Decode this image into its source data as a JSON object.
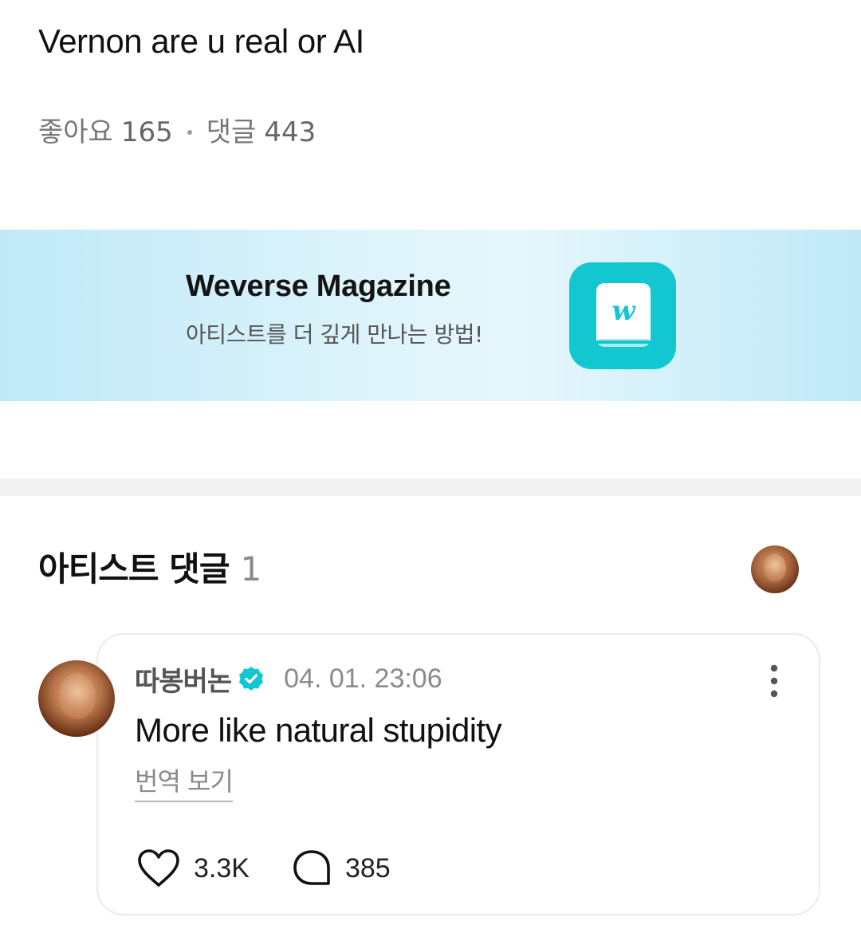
{
  "post": {
    "title": "Vernon are u real or AI",
    "likes_label": "좋아요",
    "likes_count": "165",
    "comments_label": "댓글",
    "comments_count": "443"
  },
  "banner": {
    "title": "Weverse Magazine",
    "subtitle": "아티스트를 더 깊게 만나는 방법!",
    "icon": "weverse-magazine-app-icon",
    "background_color": "#c7ecf8",
    "icon_color": "#12c7cf"
  },
  "artist_comments": {
    "heading": "아티스트 댓글",
    "count": "1",
    "comment": {
      "author": "따봉버논",
      "verified_icon": "verified-badge-icon",
      "timestamp": "04. 01. 23:06",
      "text": "More like natural stupidity",
      "translate_label": "번역 보기",
      "likes": "3.3K",
      "replies": "385",
      "like_icon": "heart-icon",
      "reply_icon": "comment-bubble-icon",
      "more_icon": "more-vertical-icon"
    }
  },
  "colors": {
    "accent": "#12c7cf",
    "muted_text": "#8a8a8a",
    "divider": "#f2f2f2"
  }
}
